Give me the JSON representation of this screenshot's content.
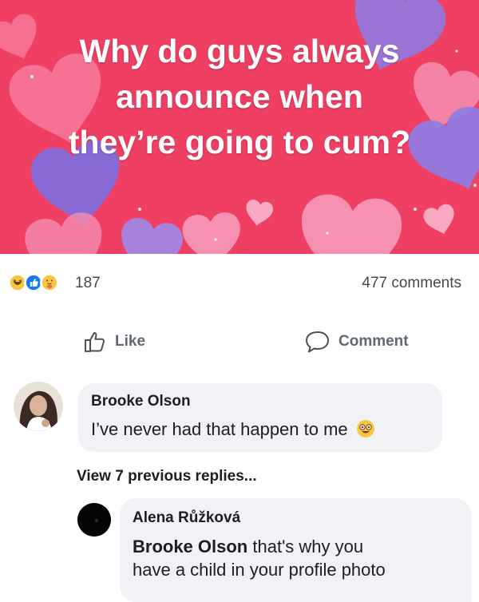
{
  "post": {
    "text": "Why do guys always\nannounce when\nthey’re going to cum?",
    "background_color": "#ef3f63"
  },
  "reactions": {
    "icons": [
      "haha-icon",
      "like-icon",
      "care-icon"
    ],
    "count": "187",
    "comments_label": "477 comments"
  },
  "actions": {
    "like_label": "Like",
    "comment_label": "Comment"
  },
  "comments": [
    {
      "author": "Brooke Olson",
      "text": "I’ve never had that happen to me",
      "emoji": "laughing-emoji"
    }
  ],
  "view_replies_label": "View 7 previous replies...",
  "reply": {
    "author": "Alena Růžková",
    "mention": "Brooke Olson",
    "text_line1": "that's why you",
    "text_line2": "have a child in your profile photo"
  }
}
